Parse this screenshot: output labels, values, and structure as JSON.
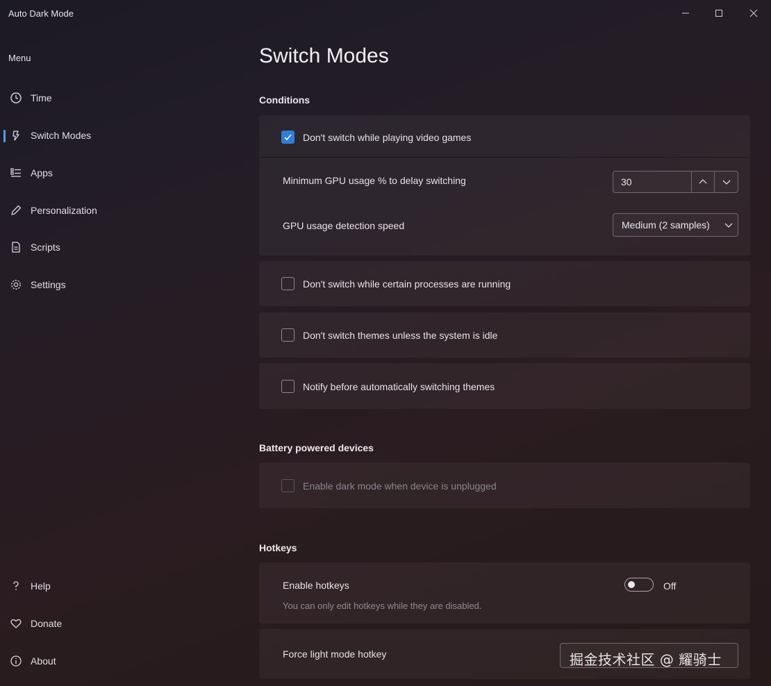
{
  "app": {
    "title": "Auto Dark Mode",
    "window_controls": {
      "minimize_icon": "minimize-icon",
      "maximize_icon": "maximize-icon",
      "close_icon": "close-icon"
    }
  },
  "sidebar": {
    "menu_label": "Menu",
    "items": [
      {
        "label": "Time",
        "icon": "clock-icon"
      },
      {
        "label": "Switch Modes",
        "icon": "switch-modes-icon",
        "active": true
      },
      {
        "label": "Apps",
        "icon": "apps-list-icon"
      },
      {
        "label": "Personalization",
        "icon": "pen-icon"
      },
      {
        "label": "Scripts",
        "icon": "script-file-icon"
      },
      {
        "label": "Settings",
        "icon": "gear-icon"
      }
    ],
    "footer_items": [
      {
        "label": "Help",
        "icon": "question-icon"
      },
      {
        "label": "Donate",
        "icon": "heart-icon"
      },
      {
        "label": "About",
        "icon": "info-icon"
      }
    ]
  },
  "main": {
    "page_title": "Switch Modes",
    "conditions": {
      "section_title": "Conditions",
      "video_games": {
        "label": "Don't switch while playing video games",
        "checked": true
      },
      "gpu_usage": {
        "label": "Minimum GPU usage % to delay switching",
        "value": "30"
      },
      "gpu_speed": {
        "label": "GPU usage detection speed",
        "value": "Medium (2 samples)"
      },
      "processes": {
        "label": "Don't switch while certain processes are running",
        "checked": false
      },
      "idle": {
        "label": "Don't switch themes unless the system is idle",
        "checked": false
      },
      "notify": {
        "label": "Notify before automatically switching themes",
        "checked": false
      }
    },
    "battery": {
      "section_title": "Battery powered devices",
      "unplugged": {
        "label": "Enable dark mode when device is unplugged",
        "checked": false,
        "disabled": true
      }
    },
    "hotkeys": {
      "section_title": "Hotkeys",
      "enable": {
        "label": "Enable hotkeys",
        "description": "You can only edit hotkeys while they are disabled.",
        "toggle_state": "Off"
      },
      "force_light": {
        "label": "Force light mode hotkey"
      }
    }
  },
  "watermark": "掘金技术社区 @ 耀骑士",
  "colors": {
    "accent": "#2f7fd8",
    "active_indicator": "#4ca0e0"
  }
}
